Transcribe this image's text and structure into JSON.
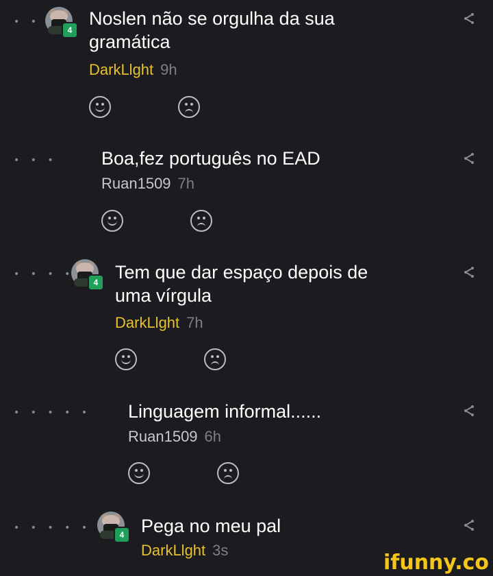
{
  "comments": [
    {
      "depth_dots": "• •",
      "has_avatar": true,
      "level_badge": "4",
      "text_line1": "Noslen não se orgulha da sua",
      "text_line2": "gramática",
      "author": "DarkLlght",
      "author_verified_color": "#e8c12d",
      "time": "9h"
    },
    {
      "depth_dots": "• • •",
      "has_avatar": false,
      "text_line1": "Boa,fez português no EAD",
      "author": "Ruan1509",
      "time": "7h"
    },
    {
      "depth_dots": "• • • •",
      "has_avatar": true,
      "level_badge": "4",
      "text_line1": "Tem que dar espaço depois de",
      "text_line2": "uma vírgula",
      "author": "DarkLlght",
      "time": "7h"
    },
    {
      "depth_dots": "• • • • •",
      "has_avatar": false,
      "text_line1": "Linguagem informal......",
      "author": "Ruan1509",
      "time": "6h"
    },
    {
      "depth_dots": "• • • • • •",
      "has_avatar": true,
      "level_badge": "4",
      "text_line1": "Pega no meu pal",
      "author": "DarkLlght",
      "time": "3s"
    }
  ],
  "icons": {
    "smile": "smile-icon",
    "frown": "frown-icon",
    "share": "share-icon"
  },
  "watermark": "ifunny.co",
  "colors": {
    "background": "#1c1c20",
    "author_highlight": "#e8c12d",
    "badge": "#1f9f5a",
    "watermark": "#f5c518"
  }
}
